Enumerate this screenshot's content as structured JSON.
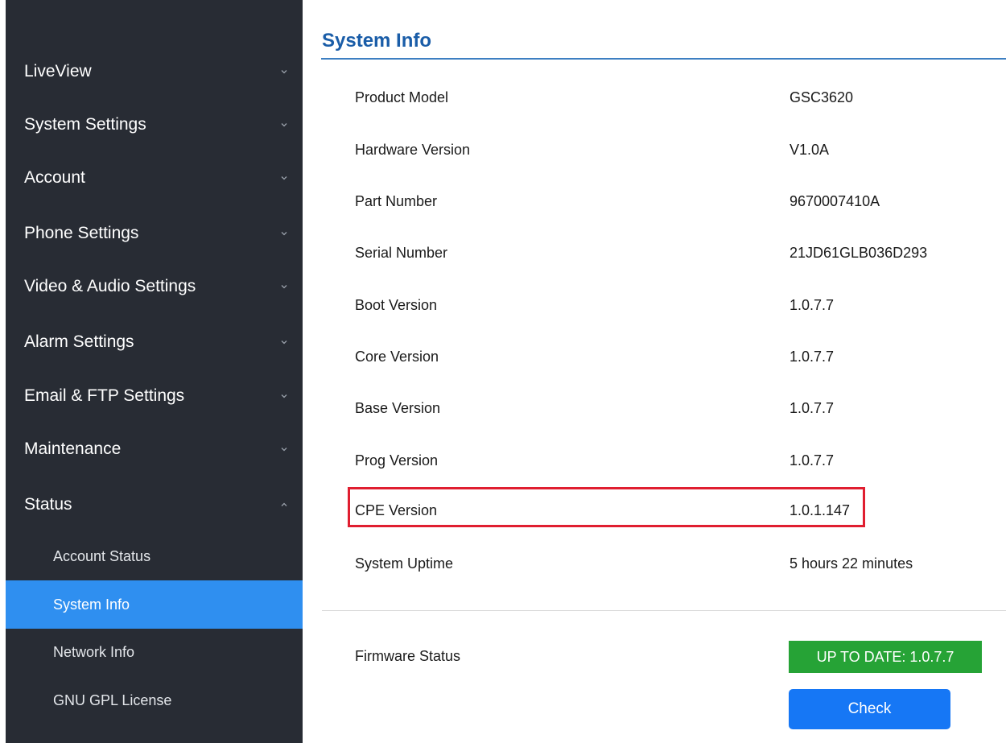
{
  "sidebar": {
    "items": [
      {
        "label": "LiveView",
        "expanded": false
      },
      {
        "label": "System Settings",
        "expanded": false
      },
      {
        "label": "Account",
        "expanded": false
      },
      {
        "label": "Phone Settings",
        "expanded": false
      },
      {
        "label": "Video & Audio Settings",
        "expanded": false
      },
      {
        "label": "Alarm Settings",
        "expanded": false
      },
      {
        "label": "Email & FTP Settings",
        "expanded": false
      },
      {
        "label": "Maintenance",
        "expanded": false
      },
      {
        "label": "Status",
        "expanded": true
      }
    ],
    "status_subitems": [
      {
        "label": "Account Status",
        "active": false
      },
      {
        "label": "System Info",
        "active": true
      },
      {
        "label": "Network Info",
        "active": false
      },
      {
        "label": "GNU GPL License",
        "active": false
      }
    ]
  },
  "main": {
    "title": "System Info",
    "rows": [
      {
        "label": "Product Model",
        "value": "GSC3620"
      },
      {
        "label": "Hardware Version",
        "value": "V1.0A"
      },
      {
        "label": "Part Number",
        "value": "9670007410A"
      },
      {
        "label": "Serial Number",
        "value": "21JD61GLB036D293"
      },
      {
        "label": "Boot Version",
        "value": "1.0.7.7"
      },
      {
        "label": "Core Version",
        "value": "1.0.7.7"
      },
      {
        "label": "Base Version",
        "value": "1.0.7.7"
      },
      {
        "label": "Prog Version",
        "value": "1.0.7.7"
      },
      {
        "label": "CPE Version",
        "value": "1.0.1.147"
      },
      {
        "label": "System Uptime",
        "value": "5 hours 22 minutes"
      }
    ],
    "firmware": {
      "label": "Firmware Status",
      "badge": "UP TO DATE: 1.0.7.7",
      "check_button": "Check"
    }
  },
  "colors": {
    "sidebar_bg": "#282c34",
    "active_item": "#2f8ff0",
    "title": "#1a5da8",
    "highlight": "#e01e30",
    "badge_green": "#26a336",
    "button_blue": "#1677f5"
  }
}
